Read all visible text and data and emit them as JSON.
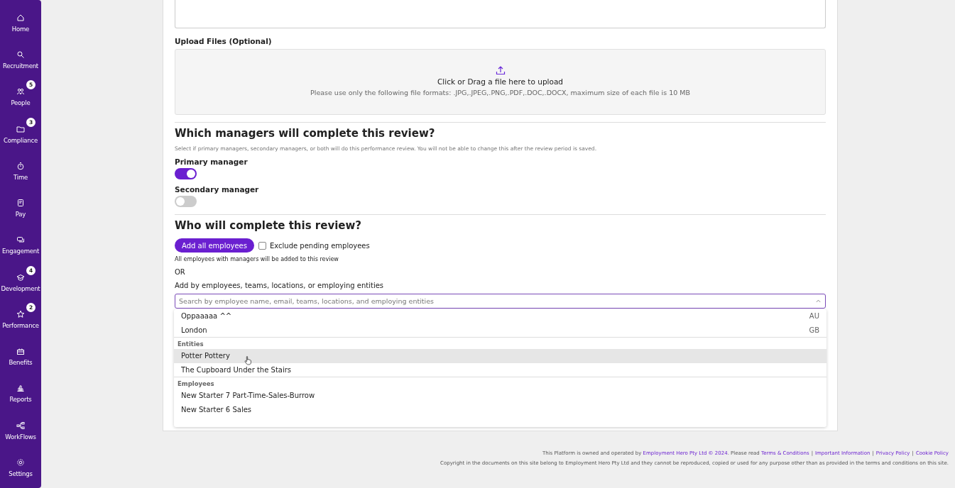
{
  "sidebar": {
    "items": [
      {
        "kind": "home",
        "label": "Home"
      },
      {
        "kind": "search",
        "label": "Recruitment"
      },
      {
        "kind": "people",
        "label": "People",
        "badge": "5"
      },
      {
        "kind": "folder",
        "label": "Compliance",
        "badge": "3"
      },
      {
        "kind": "clock",
        "label": "Time"
      },
      {
        "kind": "pay",
        "label": "Pay"
      },
      {
        "kind": "chat",
        "label": "Engagement"
      },
      {
        "kind": "cap",
        "label": "Development",
        "badge": "4"
      },
      {
        "kind": "star",
        "label": "Performance",
        "badge": "2"
      },
      {
        "kind": "gift",
        "label": "Benefits"
      },
      {
        "kind": "chart",
        "label": "Reports"
      },
      {
        "kind": "flow",
        "label": "WorkFlows"
      },
      {
        "kind": "gear",
        "label": "Settings"
      }
    ]
  },
  "upload": {
    "label": "Upload Files (Optional)",
    "prompt": "Click or Drag a file here to upload",
    "hint": "Please use only the following file formats: .JPG,.JPEG,.PNG,.PDF,.DOC,.DOCX, maximum size of each file is 10 MB"
  },
  "managers": {
    "heading": "Which managers will complete this review?",
    "description": "Select if primary managers, secondary managers, or both will do this performance review. You will not be able to change this after the review period is saved.",
    "toggles": [
      {
        "label": "Primary manager",
        "on": true
      },
      {
        "label": "Secondary manager",
        "on": false
      }
    ]
  },
  "participants": {
    "heading": "Who will complete this review?",
    "add_all_button": "Add all employees",
    "exclude_checkbox": {
      "label": "Exclude pending employees",
      "checked": false
    },
    "note": "All employees with managers will be added to this review",
    "or": "OR",
    "add_by_label": "Add by employees, teams, locations, or employing entities",
    "search": {
      "placeholder": "Search by employee name, email, teams, locations, and employing entities"
    },
    "dropdown": [
      {
        "options": [
          {
            "label": "Oppaaaaa ^^",
            "tag": "AU",
            "highlighted": false
          },
          {
            "label": "London",
            "tag": "GB",
            "highlighted": false
          }
        ]
      },
      {
        "heading": "Entities",
        "options": [
          {
            "label": "Potter Pottery",
            "highlighted": true
          },
          {
            "label": "The Cupboard Under the Stairs",
            "highlighted": false
          }
        ]
      },
      {
        "heading": "Employees",
        "options": [
          {
            "label": "New Starter 7 Part-Time-Sales-Burrow",
            "highlighted": false
          },
          {
            "label": "New Starter 6 Sales",
            "highlighted": false
          }
        ]
      }
    ]
  },
  "footer": {
    "line1": [
      {
        "kind": "text",
        "text": "This Platform is owned and operated by "
      },
      {
        "kind": "link",
        "text": "Employment Hero Pty Ltd © 2024"
      },
      {
        "kind": "text",
        "text": ". Please read "
      },
      {
        "kind": "link",
        "text": "Terms & Conditions"
      },
      {
        "kind": "sep",
        "text": "|"
      },
      {
        "kind": "link",
        "text": "Important Information"
      },
      {
        "kind": "sep",
        "text": "|"
      },
      {
        "kind": "link",
        "text": "Privacy Policy"
      },
      {
        "kind": "sep",
        "text": "|"
      },
      {
        "kind": "link",
        "text": "Cookie Policy"
      }
    ],
    "line2": "Copyright in the documents on this site belong to Employment Hero Pty Ltd and they cannot be reproduced, copied or used for any purpose other than as provided in the terms and conditions on this site."
  }
}
